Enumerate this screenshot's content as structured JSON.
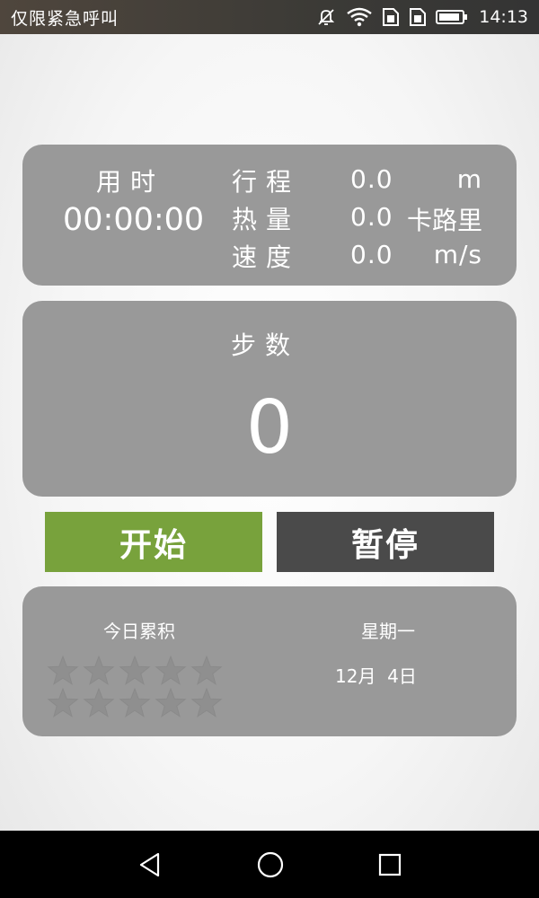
{
  "status_bar": {
    "carrier": "仅限紧急呼叫",
    "time": "14:13",
    "icons": [
      "mute-icon",
      "wifi-icon",
      "sim-card-icon",
      "sim-card-icon",
      "battery-icon"
    ]
  },
  "stats": {
    "time_label": "用时",
    "time_value": "00:00:00",
    "distance_label": "行程",
    "distance_value": "0.0",
    "distance_unit": "m",
    "calories_label": "热量",
    "calories_value": "0.0",
    "calories_unit": "卡路里",
    "speed_label": "速度",
    "speed_value": "0.0",
    "speed_unit": "m/s"
  },
  "steps": {
    "label": "步数",
    "value": "0"
  },
  "buttons": {
    "start": "开始",
    "pause": "暂停"
  },
  "summary": {
    "today_label": "今日累积",
    "weekday": "星期一",
    "date": "12月  4日",
    "stars_filled": 0,
    "stars_total": 10
  },
  "colors": {
    "panel": "#999999",
    "start_button": "#78a23c",
    "pause_button": "#4a4a4a",
    "star_empty": "#8f8f8f"
  }
}
